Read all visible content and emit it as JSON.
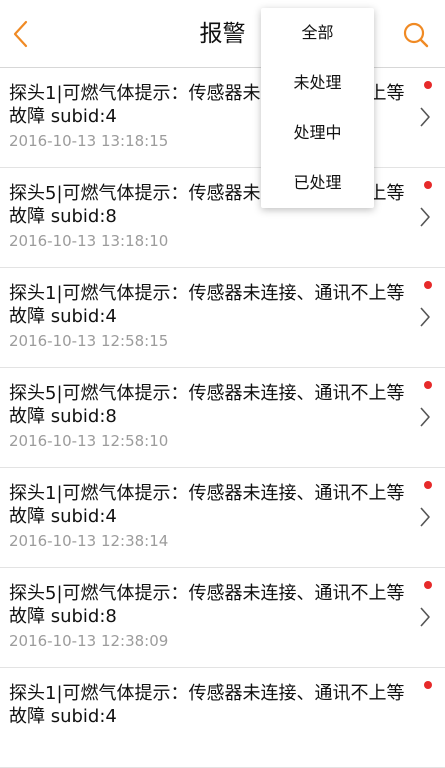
{
  "header": {
    "title": "报警",
    "back_icon": "chevron-left-icon",
    "search_icon": "search-icon",
    "accent_color": "#f08a24"
  },
  "filter_menu": {
    "items": [
      {
        "label": "全部"
      },
      {
        "label": "未处理"
      },
      {
        "label": "处理中"
      },
      {
        "label": "已处理"
      }
    ]
  },
  "alarms": [
    {
      "text": "探头1|可燃气体提示：传感器未连接、通讯不上等故障 subid:4",
      "time": "2016-10-13 13:18:15",
      "unread": true
    },
    {
      "text": "探头5|可燃气体提示：传感器未连接、通讯不上等故障 subid:8",
      "time": "2016-10-13 13:18:10",
      "unread": true
    },
    {
      "text": "探头1|可燃气体提示：传感器未连接、通讯不上等故障 subid:4",
      "time": "2016-10-13 12:58:15",
      "unread": true
    },
    {
      "text": "探头5|可燃气体提示：传感器未连接、通讯不上等故障 subid:8",
      "time": "2016-10-13 12:58:10",
      "unread": true
    },
    {
      "text": "探头1|可燃气体提示：传感器未连接、通讯不上等故障 subid:4",
      "time": "2016-10-13 12:38:14",
      "unread": true
    },
    {
      "text": "探头5|可燃气体提示：传感器未连接、通讯不上等故障 subid:8",
      "time": "2016-10-13 12:38:09",
      "unread": true
    },
    {
      "text": "探头1|可燃气体提示：传感器未连接、通讯不上等故障 subid:4",
      "time": "",
      "unread": true
    }
  ],
  "colors": {
    "unread_dot": "#e62a2a",
    "time_text": "#9c9c9c",
    "divider": "#e3e3e3"
  }
}
